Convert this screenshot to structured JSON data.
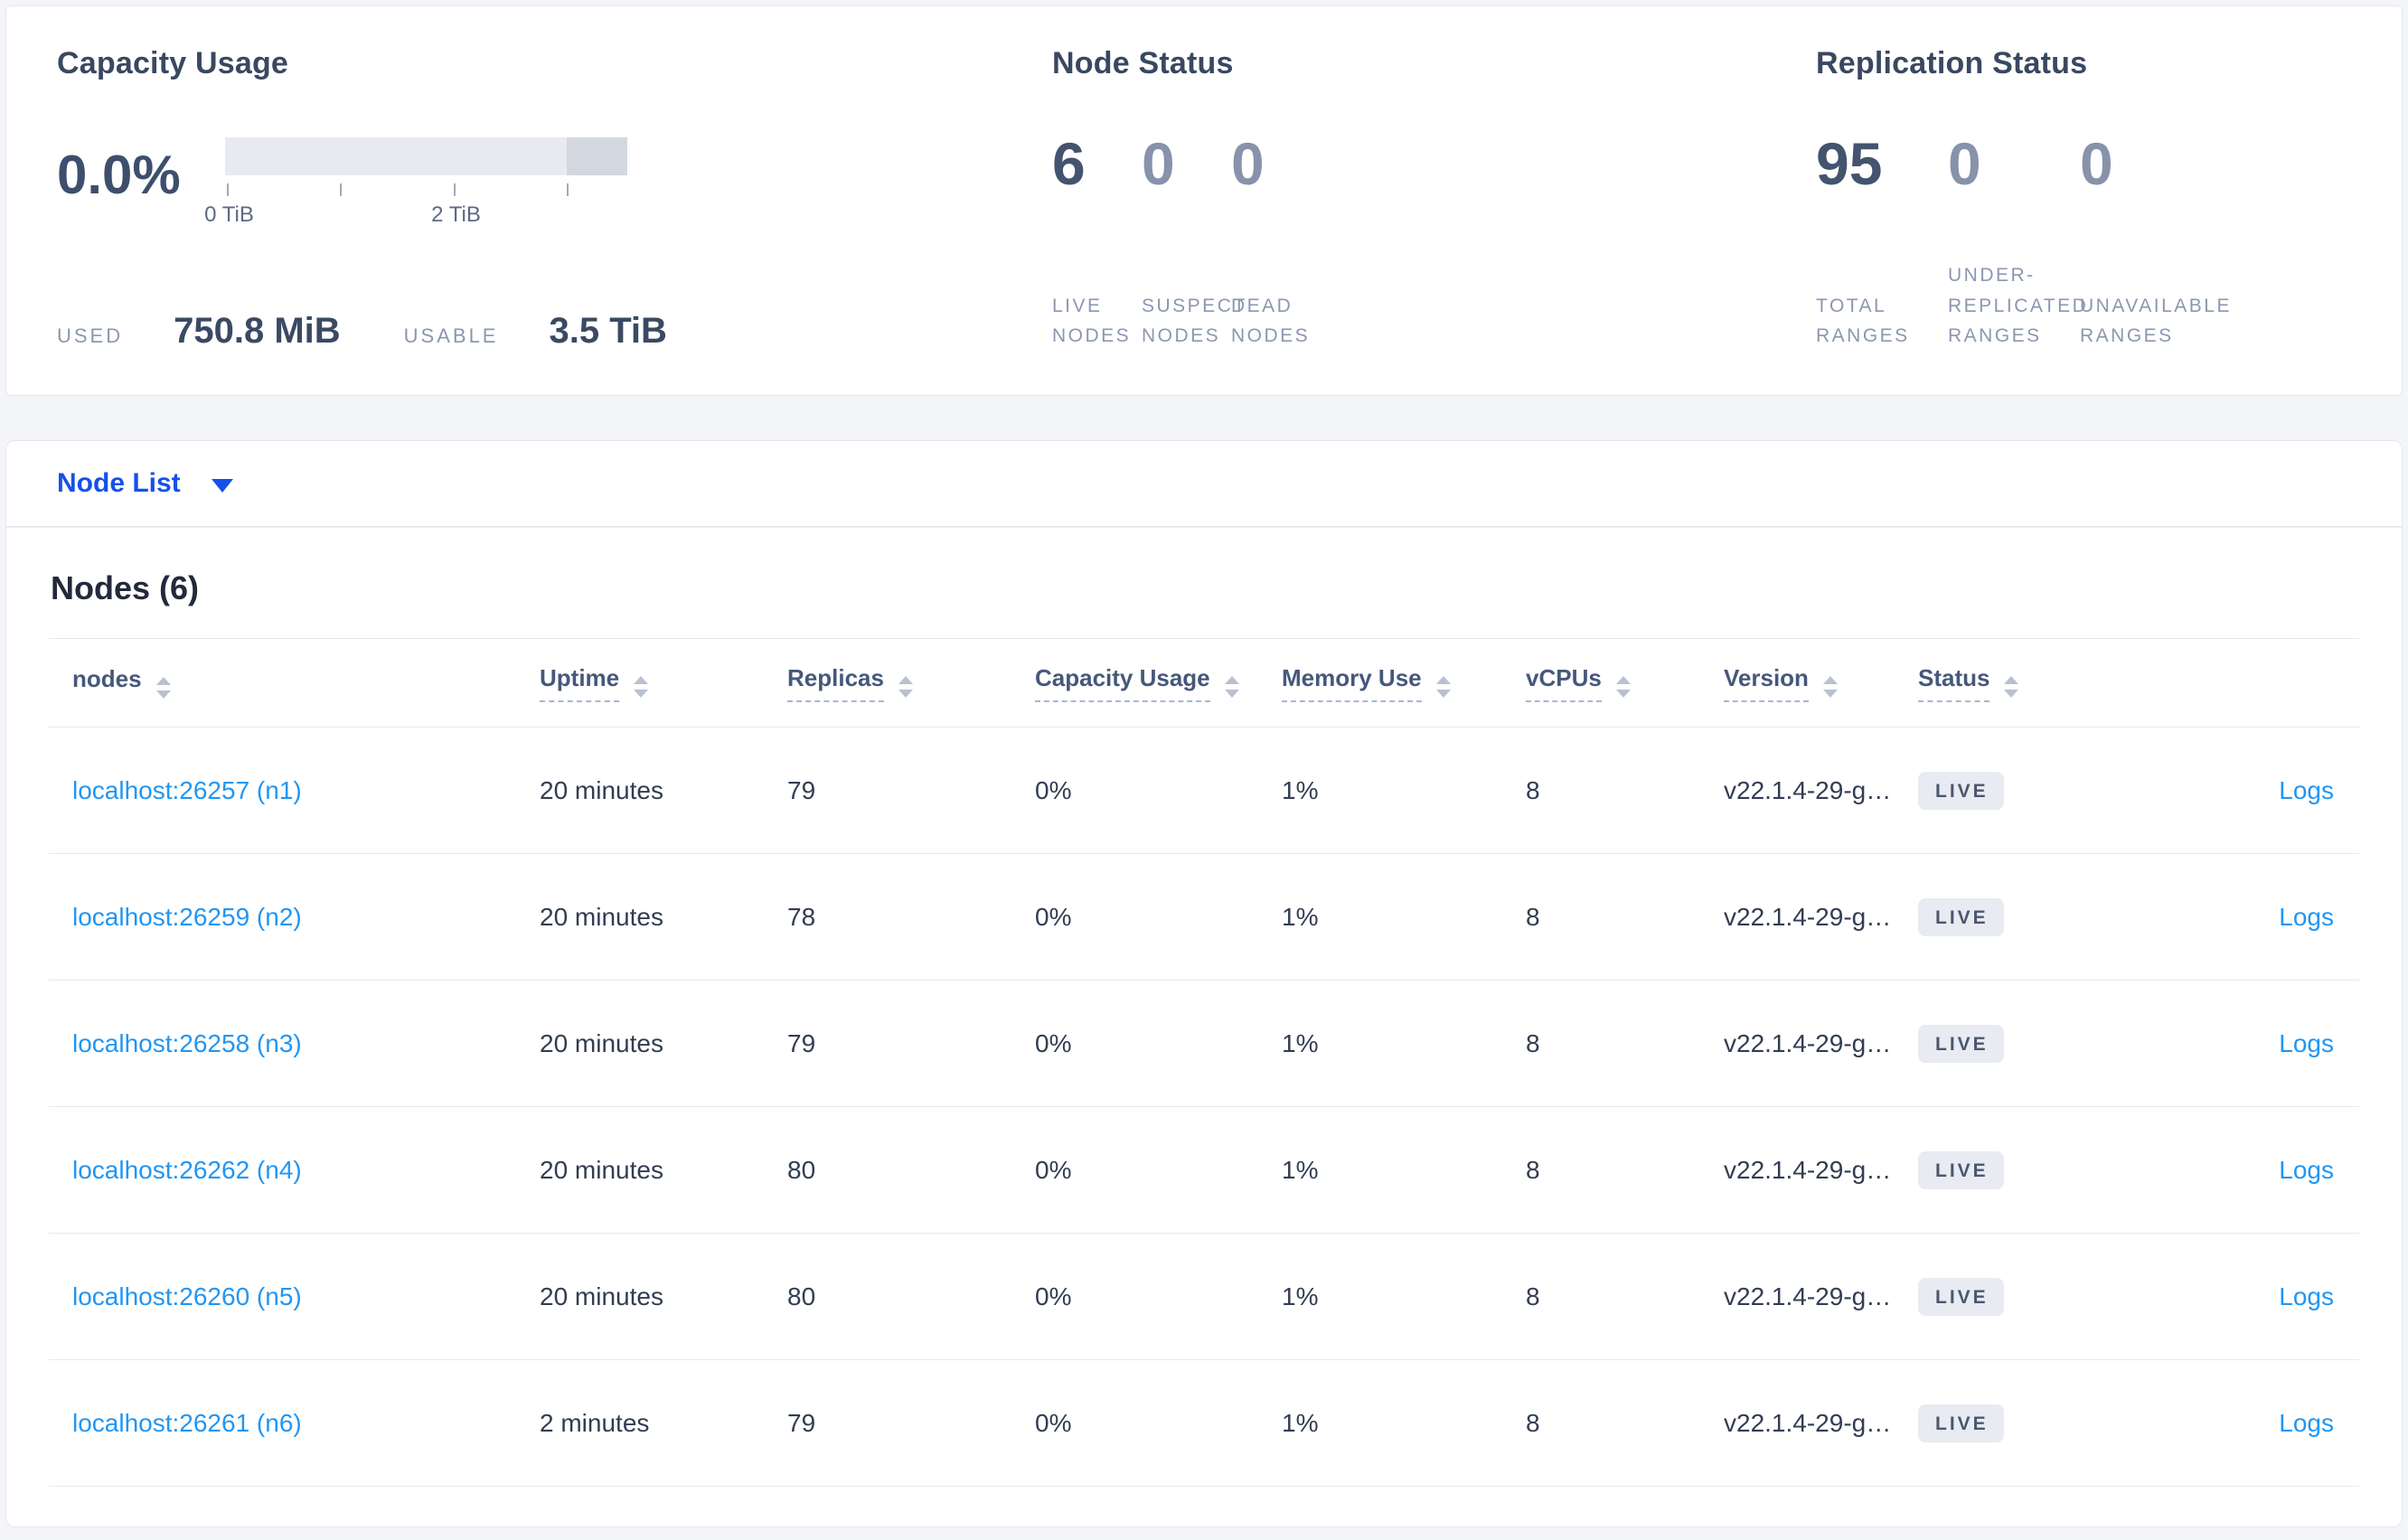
{
  "colors": {
    "page_background": "#f4f5f9",
    "accent_blue": "#1551e9",
    "link_blue": "#2196f3",
    "badge_background": "#e8ebf1",
    "bar_track": "#e8eaf0",
    "bar_tail": "#d3d7e0"
  },
  "summary": {
    "capacity": {
      "title": "Capacity Usage",
      "percent": "0.0%",
      "tick_labels": [
        {
          "text": "0 TiB"
        },
        {
          "text": "2 TiB"
        }
      ],
      "used_label": "USED",
      "used_value": "750.8 MiB",
      "usable_label": "USABLE",
      "usable_value": "3.5 TiB"
    },
    "node_status": {
      "title": "Node Status",
      "metrics": [
        {
          "value": "6",
          "label": "LIVE NODES",
          "emphasis": true
        },
        {
          "value": "0",
          "label": "SUSPECT NODES",
          "emphasis": false
        },
        {
          "value": "0",
          "label": "DEAD NODES",
          "emphasis": false
        }
      ]
    },
    "replication": {
      "title": "Replication Status",
      "metrics": [
        {
          "value": "95",
          "label": "TOTAL RANGES",
          "emphasis": true
        },
        {
          "value": "0",
          "label": "UNDER-REPLICATED RANGES",
          "emphasis": false
        },
        {
          "value": "0",
          "label": "UNAVAILABLE RANGES",
          "emphasis": false
        }
      ]
    }
  },
  "view_selector": {
    "label": "Node List"
  },
  "nodes_section": {
    "title": "Nodes (6)",
    "columns": [
      {
        "label": "nodes",
        "sortable": true,
        "underline": false
      },
      {
        "label": "Uptime",
        "sortable": true,
        "underline": true
      },
      {
        "label": "Replicas",
        "sortable": true,
        "underline": true
      },
      {
        "label": "Capacity Usage",
        "sortable": true,
        "underline": true
      },
      {
        "label": "Memory Use",
        "sortable": true,
        "underline": true
      },
      {
        "label": "vCPUs",
        "sortable": true,
        "underline": true
      },
      {
        "label": "Version",
        "sortable": true,
        "underline": true
      },
      {
        "label": "Status",
        "sortable": true,
        "underline": true
      },
      {
        "label": "",
        "sortable": false,
        "underline": false
      }
    ],
    "rows": [
      {
        "address": "localhost:26257 (n1)",
        "uptime": "20 minutes",
        "replicas": "79",
        "capacity": "0%",
        "memory": "1%",
        "vcpus": "8",
        "version": "v22.1.4-29-g…",
        "status": "LIVE",
        "logs": "Logs"
      },
      {
        "address": "localhost:26259 (n2)",
        "uptime": "20 minutes",
        "replicas": "78",
        "capacity": "0%",
        "memory": "1%",
        "vcpus": "8",
        "version": "v22.1.4-29-g…",
        "status": "LIVE",
        "logs": "Logs"
      },
      {
        "address": "localhost:26258 (n3)",
        "uptime": "20 minutes",
        "replicas": "79",
        "capacity": "0%",
        "memory": "1%",
        "vcpus": "8",
        "version": "v22.1.4-29-g…",
        "status": "LIVE",
        "logs": "Logs"
      },
      {
        "address": "localhost:26262 (n4)",
        "uptime": "20 minutes",
        "replicas": "80",
        "capacity": "0%",
        "memory": "1%",
        "vcpus": "8",
        "version": "v22.1.4-29-g…",
        "status": "LIVE",
        "logs": "Logs"
      },
      {
        "address": "localhost:26260 (n5)",
        "uptime": "20 minutes",
        "replicas": "80",
        "capacity": "0%",
        "memory": "1%",
        "vcpus": "8",
        "version": "v22.1.4-29-g…",
        "status": "LIVE",
        "logs": "Logs"
      },
      {
        "address": "localhost:26261 (n6)",
        "uptime": "2 minutes",
        "replicas": "79",
        "capacity": "0%",
        "memory": "1%",
        "vcpus": "8",
        "version": "v22.1.4-29-g…",
        "status": "LIVE",
        "logs": "Logs"
      }
    ]
  }
}
